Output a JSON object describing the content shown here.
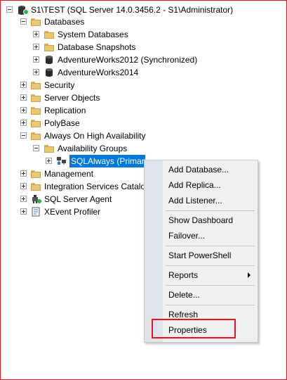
{
  "tree": {
    "server": "S1\\TEST (SQL Server 14.0.3456.2 - S1\\Administrator)",
    "databases": "Databases",
    "system_databases": "System Databases",
    "database_snapshots": "Database Snapshots",
    "adventureworks2012": "AdventureWorks2012 (Synchronized)",
    "adventureworks2014": "AdventureWorks2014",
    "security": "Security",
    "server_objects": "Server Objects",
    "replication": "Replication",
    "polybase": "PolyBase",
    "always_on": "Always On High Availability",
    "availability_groups": "Availability Groups",
    "sqlalways": "SQLAlways (Primary)",
    "management": "Management",
    "integration_services": "Integration Services Catalogs",
    "server_agent": "SQL Server Agent",
    "xevent_profiler": "XEvent Profiler"
  },
  "menu": {
    "add_database": "Add Database...",
    "add_replica": "Add Replica...",
    "add_listener": "Add Listener...",
    "show_dashboard": "Show Dashboard",
    "failover": "Failover...",
    "start_powershell": "Start PowerShell",
    "reports": "Reports",
    "delete": "Delete...",
    "refresh": "Refresh",
    "properties": "Properties"
  },
  "colors": {
    "selection": "#0078d7",
    "highlight_border": "#e81123",
    "frame_border": "#e81123"
  }
}
